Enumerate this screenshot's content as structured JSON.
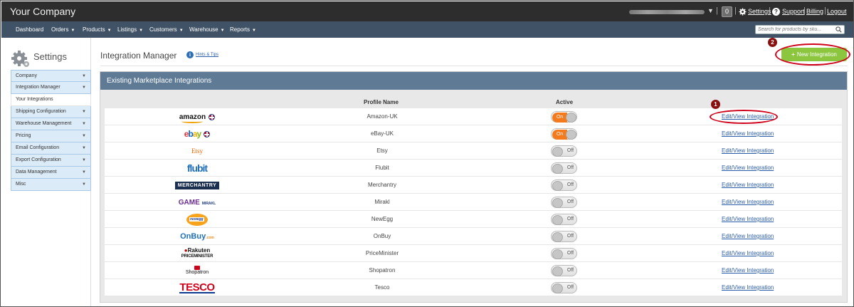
{
  "topbar": {
    "brand": "Your Company",
    "notification_count": "0",
    "settings": "Settings",
    "support": "Support",
    "billing": "Billing",
    "logout": "Logout",
    "sep": "|"
  },
  "nav": {
    "items": [
      "Dashboard",
      "Orders",
      "Products",
      "Listings",
      "Customers",
      "Warehouse",
      "Reports"
    ],
    "dropdown_caret": "▼",
    "search_placeholder": "Search for products by sku..."
  },
  "sidebar": {
    "title": "Settings",
    "items": [
      {
        "label": "Company",
        "caret": "▼"
      },
      {
        "label": "Integration Manager",
        "caret": "▼"
      },
      {
        "label": "Your Integrations",
        "caret": ""
      },
      {
        "label": "Shipping Configuration",
        "caret": "▼"
      },
      {
        "label": "Warehouse Management",
        "caret": "▼"
      },
      {
        "label": "Pricing",
        "caret": "▼"
      },
      {
        "label": "Email Configuration",
        "caret": "▼"
      },
      {
        "label": "Export Configuration",
        "caret": "▼"
      },
      {
        "label": "Data Management",
        "caret": "▼"
      },
      {
        "label": "Misc",
        "caret": "▼"
      }
    ]
  },
  "page": {
    "title": "Integration Manager",
    "hints_label": "Hints & Tips",
    "new_button": "New Integration",
    "callout_new": "2",
    "callout_edit": "1"
  },
  "panel": {
    "heading": "Existing Marketplace Integrations",
    "col_profile": "Profile Name",
    "col_active": "Active",
    "on_label": "On",
    "off_label": "Off",
    "edit_label": "Edit/View Integration"
  },
  "integrations": [
    {
      "name": "Amazon-UK",
      "logo": "amazon",
      "active": true
    },
    {
      "name": "eBay-UK",
      "logo": "ebay",
      "active": true
    },
    {
      "name": "Etsy",
      "logo": "etsy",
      "active": false
    },
    {
      "name": "Flubit",
      "logo": "flubit",
      "active": false
    },
    {
      "name": "Merchantry",
      "logo": "merchantry",
      "active": false
    },
    {
      "name": "Mirakl",
      "logo": "game-mirakl",
      "active": false
    },
    {
      "name": "NewEgg",
      "logo": "newegg",
      "active": false
    },
    {
      "name": "OnBuy",
      "logo": "onbuy",
      "active": false
    },
    {
      "name": "PriceMinister",
      "logo": "rakuten-priceminister",
      "active": false
    },
    {
      "name": "Shopatron",
      "logo": "shopatron",
      "active": false
    },
    {
      "name": "Tesco",
      "logo": "tesco",
      "active": false
    }
  ],
  "logo_text": {
    "amazon": "amazon",
    "ebay": [
      "e",
      "b",
      "a",
      "y"
    ],
    "etsy": "Etsy",
    "flubit": "flubit",
    "merchantry": "MERCHANTRY",
    "game": "GAME",
    "mirakl": "MIRAKL",
    "newegg": "newegg",
    "onbuy": "OnBuy",
    "onbuy_com": ".com",
    "rakuten": "Rakuten",
    "priceminister": "PRICEMINISTER",
    "shopatron": "Shopatron",
    "tesco": "TESCO"
  },
  "colors": {
    "accent_green": "#8cc63f",
    "toggle_on": "#f57a1d",
    "panel_header": "#5e7a95",
    "nav_bg": "#3f5266",
    "annotation_red": "#d0021b"
  }
}
